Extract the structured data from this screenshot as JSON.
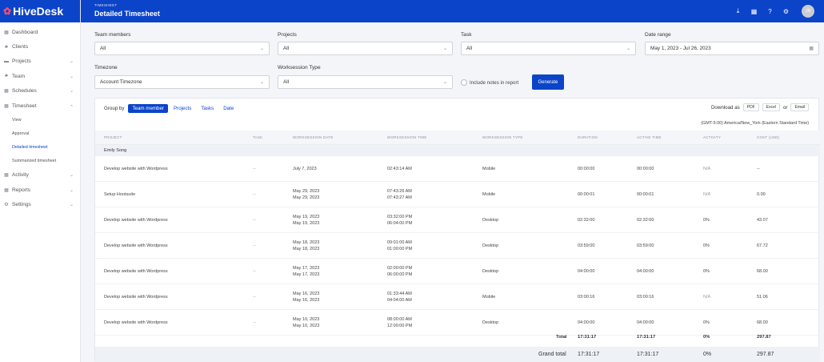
{
  "app": {
    "name": "HiveDesk",
    "logo_mark": "✿",
    "avatar_initials": "JR"
  },
  "sidebar": {
    "items": [
      {
        "label": "Dashboard",
        "icon": "▦"
      },
      {
        "label": "Clients",
        "icon": "♣"
      },
      {
        "label": "Projects",
        "icon": "▬",
        "chevron": true
      },
      {
        "label": "Team",
        "icon": "♣",
        "chevron": true
      },
      {
        "label": "Schedules",
        "icon": "▦",
        "chevron": true
      },
      {
        "label": "Timesheet",
        "icon": "▦",
        "chevron": true,
        "open": true
      },
      {
        "label": "Activity",
        "icon": "▦",
        "chevron": true
      },
      {
        "label": "Reports",
        "icon": "▦",
        "chevron": true
      },
      {
        "label": "Settings",
        "icon": "⚙",
        "chevron": true
      }
    ],
    "timesheet_sub": [
      "View",
      "Approval",
      "Detailed timesheet",
      "Summarized timesheet"
    ]
  },
  "header": {
    "breadcrumb": "TIMESHEET",
    "title": "Detailed Timesheet"
  },
  "filters": {
    "team_members": {
      "label": "Team members",
      "value": "All"
    },
    "projects": {
      "label": "Projects",
      "value": "All"
    },
    "task": {
      "label": "Task",
      "value": "All"
    },
    "date_range": {
      "label": "Date range",
      "value": "May 1, 2023 - Jul 26, 2023"
    },
    "timezone": {
      "label": "Timezone",
      "value": "Account Timezone"
    },
    "worksession_type": {
      "label": "Worksession Type",
      "value": "All"
    },
    "include_notes": "Include notes in report",
    "generate": "Generate"
  },
  "group_by": {
    "label": "Group by",
    "options": [
      "Team member",
      "Projects",
      "Tasks",
      "Date"
    ]
  },
  "download": {
    "label": "Download as",
    "pdf": "PDF",
    "excel": "Excel",
    "or": "or",
    "email": "Email"
  },
  "timezone_note": "(GMT-5:00) America/New_York (Eastern Standard Time)",
  "columns": [
    "Project",
    "Task",
    "Worksession date",
    "Worksession time",
    "Worksession type",
    "Duration",
    "Active time",
    "Activity",
    "Cost (USD)"
  ],
  "group_name": "Emily Song",
  "rows": [
    {
      "project": "Develop website with Wordpress",
      "task": "--",
      "date1": "July 7, 2023",
      "date2": "",
      "time1": "02:43:14 AM",
      "time2": "",
      "type": "Mobile",
      "duration": "00:00:00",
      "active": "00:00:00",
      "activity": "N/A",
      "cost": "--"
    },
    {
      "project": "Setup Hootsuite",
      "task": "--",
      "date1": "May 29, 2023",
      "date2": "May 29, 2023",
      "time1": "07:43:26 AM",
      "time2": "07:43:27 AM",
      "type": "Mobile",
      "duration": "00:00:01",
      "active": "00:00:01",
      "activity": "N/A",
      "cost": "0.00"
    },
    {
      "project": "Develop website with Wordpress",
      "task": "--",
      "date1": "May 19, 2023",
      "date2": "May 19, 2023",
      "time1": "03:32:00 PM",
      "time2": "06:04:00 PM",
      "type": "Desktop",
      "duration": "02:32:00",
      "active": "02:32:00",
      "activity": "0%",
      "cost": "43.07"
    },
    {
      "project": "Develop website with Wordpress",
      "task": "--",
      "date1": "May 18, 2023",
      "date2": "May 18, 2023",
      "time1": "09:01:00 AM",
      "time2": "01:00:00 PM",
      "type": "Desktop",
      "duration": "03:59:00",
      "active": "03:59:00",
      "activity": "0%",
      "cost": "67.72"
    },
    {
      "project": "Develop website with Wordpress",
      "task": "--",
      "date1": "May 17, 2023",
      "date2": "May 17, 2023",
      "time1": "02:00:00 PM",
      "time2": "06:00:00 PM",
      "type": "Desktop",
      "duration": "04:00:00",
      "active": "04:00:00",
      "activity": "0%",
      "cost": "68.00"
    },
    {
      "project": "Develop website with Wordpress",
      "task": "--",
      "date1": "May 16, 2023",
      "date2": "May 16, 2023",
      "time1": "01:33:44 AM",
      "time2": "04:04:00 AM",
      "type": "Mobile",
      "duration": "03:00:16",
      "active": "03:00:16",
      "activity": "N/A",
      "cost": "51.06"
    },
    {
      "project": "Develop website with Wordpress",
      "task": "--",
      "date1": "May 10, 2023",
      "date2": "May 10, 2023",
      "time1": "08:00:00 AM",
      "time2": "12:00:00 PM",
      "type": "Desktop",
      "duration": "04:00:00",
      "active": "04:00:00",
      "activity": "0%",
      "cost": "68.00"
    }
  ],
  "total": {
    "label": "Total",
    "duration": "17:31:17",
    "active": "17:31:17",
    "activity": "0%",
    "cost": "297.87"
  },
  "grand_total": {
    "label": "Grand total",
    "duration": "17:31:17",
    "active": "17:31:17",
    "activity": "0%",
    "cost": "297.87"
  }
}
